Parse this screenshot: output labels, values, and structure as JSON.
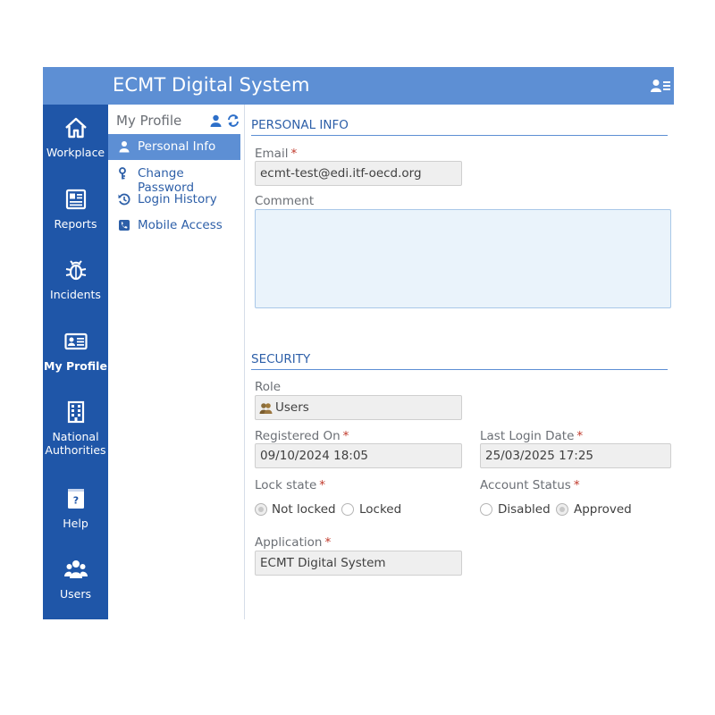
{
  "header": {
    "title": "ECMT Digital System",
    "user_menu_icon": "user-list-icon"
  },
  "nav": {
    "items": [
      {
        "label": "Workplace",
        "icon": "home-icon"
      },
      {
        "label": "Reports",
        "icon": "newspaper-icon"
      },
      {
        "label": "Incidents",
        "icon": "bug-icon"
      },
      {
        "label": "My Profile",
        "icon": "id-card-icon",
        "active": true
      },
      {
        "label_line1": "National",
        "label_line2": "Authorities",
        "icon": "building-icon"
      },
      {
        "label": "Help",
        "icon": "help-book-icon"
      },
      {
        "label": "Users",
        "icon": "users-icon"
      }
    ]
  },
  "submenu": {
    "title": "My Profile",
    "items": [
      {
        "label": "Personal Info",
        "icon": "user-icon",
        "active": true
      },
      {
        "label": "Change Password",
        "icon": "key-icon"
      },
      {
        "label": "Login History",
        "icon": "history-icon"
      },
      {
        "label": "Mobile Access",
        "icon": "phone-icon"
      }
    ]
  },
  "personal_info": {
    "section_title": "PERSONAL INFO",
    "email_label": "Email",
    "email_required": "*",
    "email_value": "ecmt-test@edi.itf-oecd.org",
    "comment_label": "Comment",
    "comment_value": ""
  },
  "security": {
    "section_title": "SECURITY",
    "role_label": "Role",
    "role_value": "Users",
    "registered_on_label": "Registered On",
    "registered_on_value": "09/10/2024 18:05",
    "last_login_label": "Last Login Date",
    "last_login_value": "25/03/2025 17:25",
    "lock_state_label": "Lock state",
    "lock_state_options": [
      "Not locked",
      "Locked"
    ],
    "lock_state_selected": "Not locked",
    "account_status_label": "Account Status",
    "account_status_options": [
      "Disabled",
      "Approved"
    ],
    "account_status_selected": "Approved",
    "application_label": "Application",
    "application_value": "ECMT Digital System",
    "required_mark": "*"
  },
  "colors": {
    "header_bg": "#5d8fd4",
    "nav_bg": "#1f56a8",
    "accent": "#2d5fa8",
    "required": "#c0392b"
  }
}
